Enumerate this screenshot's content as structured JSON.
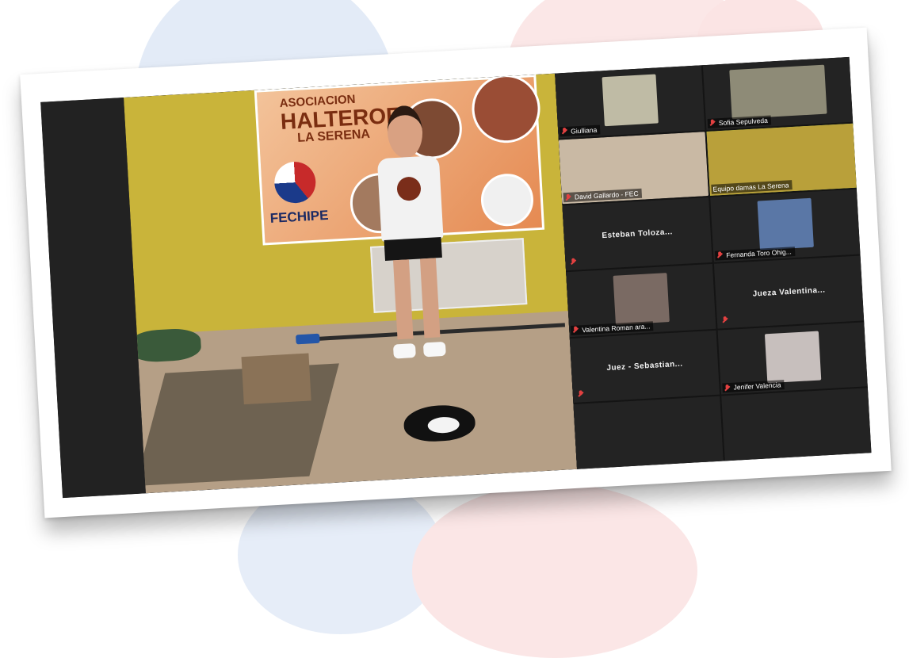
{
  "main_speaker": {
    "banner_line1": "ASOCIACION",
    "banner_line2": "HALTEROFILIA",
    "banner_line3": "LA SERENA",
    "banner_logo_text": "FECHIPE"
  },
  "participants": [
    {
      "name": "Giulliana",
      "mic_muted": true,
      "video": true,
      "thumb_color": "#bfbba5"
    },
    {
      "name": "Sofia Sepulveda",
      "mic_muted": true,
      "video": true,
      "thumb_color": "#8e8b77"
    },
    {
      "name": "David Gallardo - FEC",
      "mic_muted": true,
      "video": true,
      "thumb_color": "#c9b9a4"
    },
    {
      "name": "Equipo damas La Serena",
      "mic_muted": false,
      "video": true,
      "active": true,
      "thumb_color": "#b9a03a"
    },
    {
      "display_name": "Esteban  Toloza...",
      "mic_muted": true,
      "video": false
    },
    {
      "name": "Fernanda Toro Ohig...",
      "mic_muted": true,
      "video": true,
      "thumb_color": "#5a77a6"
    },
    {
      "name": "Valentina Roman ara...",
      "mic_muted": true,
      "video": true,
      "thumb_color": "#7a6a63"
    },
    {
      "display_name": "Jueza  Valentina...",
      "mic_muted": true,
      "video": false
    },
    {
      "display_name": "Juez  -  Sebastian...",
      "mic_muted": true,
      "video": false
    },
    {
      "name": "Jenifer Valencia",
      "mic_muted": true,
      "video": true,
      "thumb_color": "#c7bfbd"
    }
  ],
  "colors": {
    "active_outline": "#c5dc3f",
    "muted_icon": "#e34141",
    "tile_bg": "#232323"
  },
  "icons": {
    "muted": "muted-mic-icon"
  }
}
